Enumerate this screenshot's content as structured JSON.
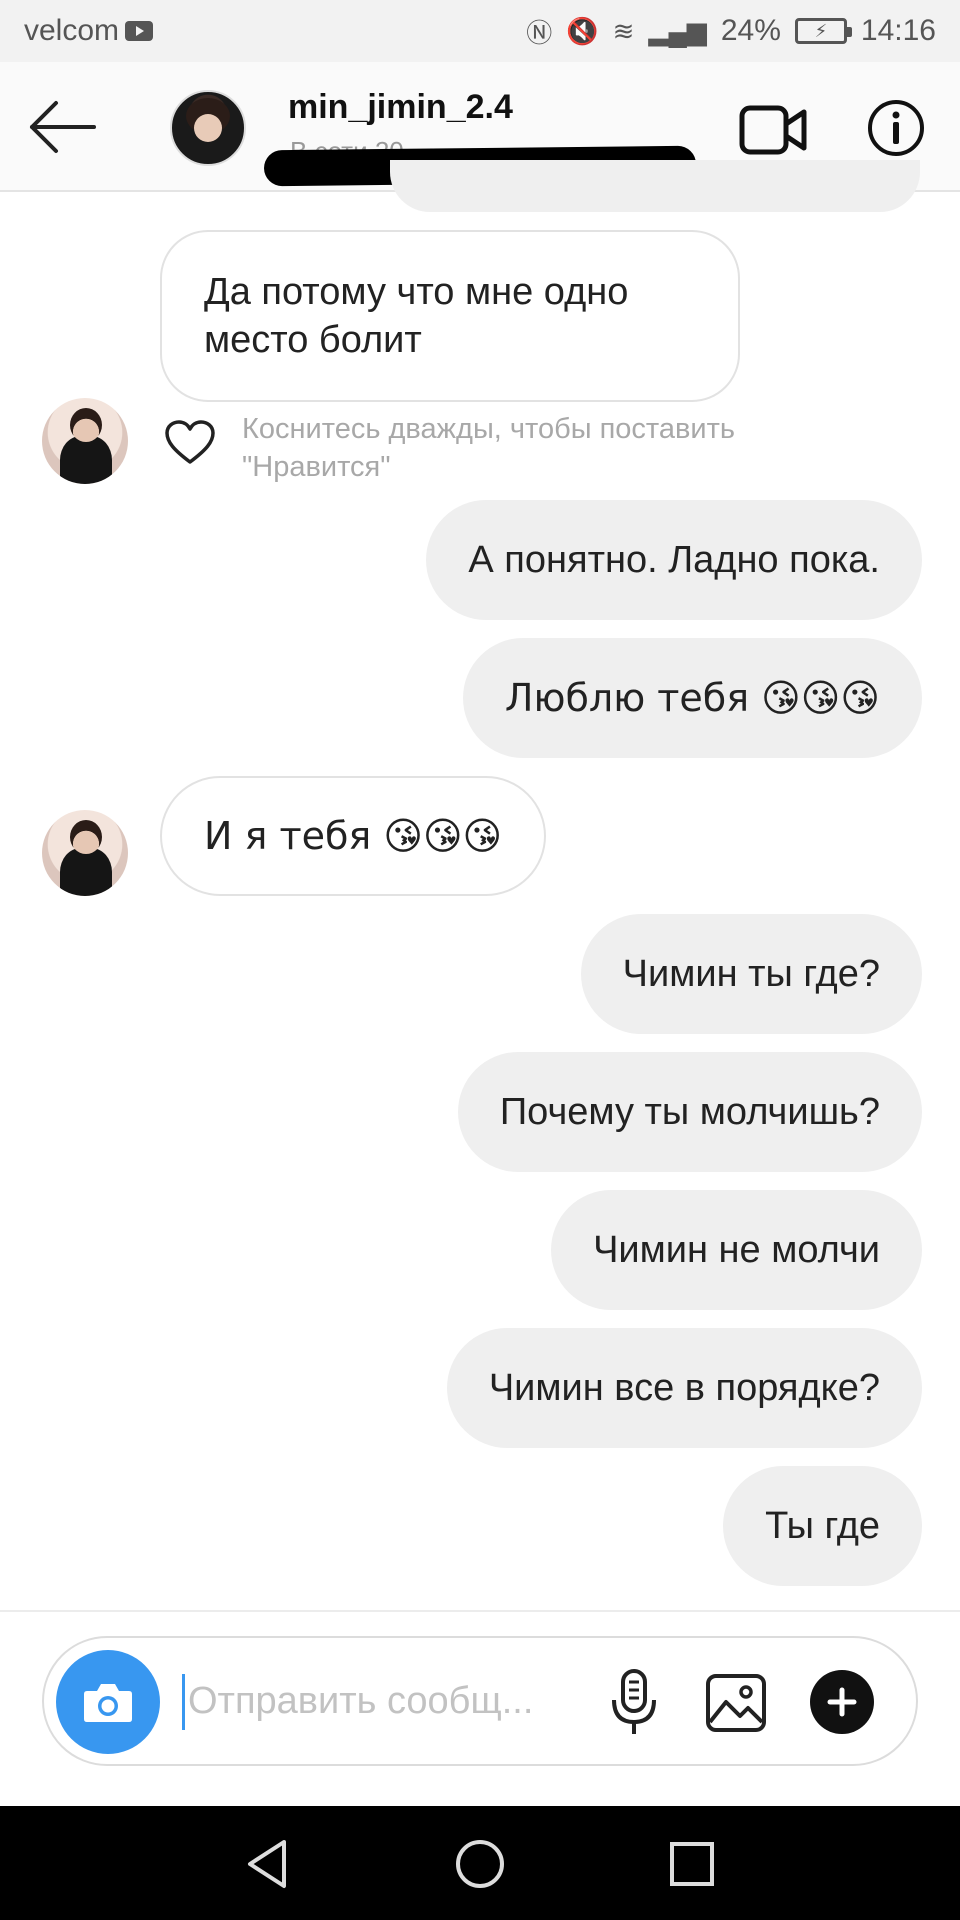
{
  "status_bar": {
    "carrier": "velcom",
    "battery": "24%",
    "time": "14:16"
  },
  "header": {
    "username": "min_jimin_2.4",
    "subtitle_partial": "В сети 20"
  },
  "messages": [
    {
      "sender": "them",
      "text": "Да потому что мне одно место болит"
    },
    {
      "sender": "me",
      "text": "А понятно. Ладно пока."
    },
    {
      "sender": "me",
      "text": "Люблю тебя 😘😘😘"
    },
    {
      "sender": "them",
      "text": "И я тебя 😘😘😘"
    },
    {
      "sender": "me",
      "text": "Чимин ты где?"
    },
    {
      "sender": "me",
      "text": "Почему ты молчишь?"
    },
    {
      "sender": "me",
      "text": "Чимин не молчи"
    },
    {
      "sender": "me",
      "text": "Чимин все в порядке?"
    },
    {
      "sender": "me",
      "text": "Ты где"
    }
  ],
  "like_hint": "Коснитесь дважды, чтобы поставить \"Нравится\"",
  "composer": {
    "placeholder": "Отправить сообщ..."
  },
  "icons": {
    "back": "arrow-left-icon",
    "video": "video-camera-icon",
    "info": "info-icon",
    "heart": "heart-icon",
    "camera": "camera-icon",
    "mic": "microphone-icon",
    "gallery": "image-icon",
    "plus": "plus-icon"
  },
  "colors": {
    "accent": "#3897f0",
    "bubble_me": "#efefef",
    "bubble_them_border": "#e2e2e2"
  }
}
